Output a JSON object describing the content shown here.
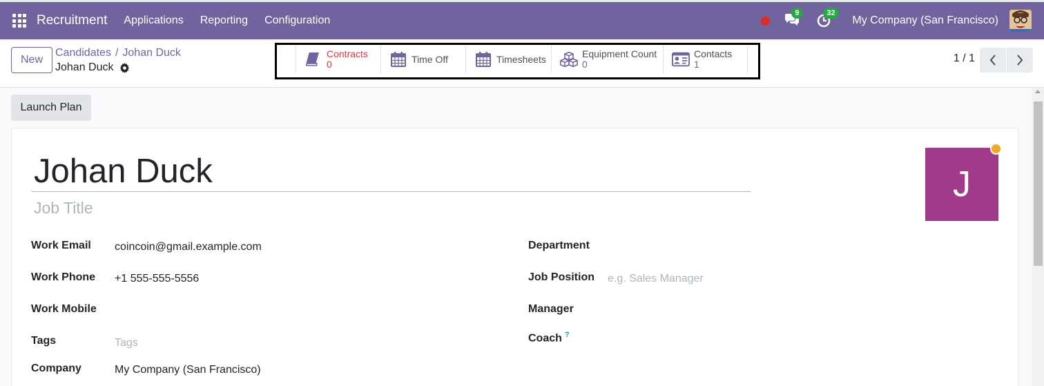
{
  "navbar": {
    "brand": "Recruitment",
    "menu": [
      "Applications",
      "Reporting",
      "Configuration"
    ],
    "messages_count": "9",
    "activities_count": "32",
    "company": "My Company (San Francisco)",
    "color": "#71639e"
  },
  "control": {
    "new_label": "New",
    "breadcrumb": [
      "Candidates",
      "Johan Duck"
    ],
    "record_name": "Johan Duck",
    "smart_buttons": [
      {
        "label": "Contracts",
        "count": "0",
        "icon": "book-icon"
      },
      {
        "label": "Time Off",
        "icon": "calendar-icon"
      },
      {
        "label": "Timesheets",
        "icon": "calendar-icon"
      },
      {
        "label": "Equipment Count",
        "count": "0",
        "icon": "cubes-icon"
      },
      {
        "label": "Contacts",
        "count": "1",
        "icon": "id-card-icon"
      }
    ],
    "pager": "1 / 1"
  },
  "form": {
    "launch_plan": "Launch Plan",
    "name": "Johan Duck",
    "job_title_placeholder": "Job Title",
    "avatar_letter": "J",
    "left_fields": [
      {
        "label": "Work Email",
        "value": "coincoin@gmail.example.com"
      },
      {
        "label": "Work Phone",
        "value": "+1 555-555-5556"
      },
      {
        "label": "Work Mobile",
        "value": ""
      },
      {
        "label": "Tags",
        "placeholder": "Tags"
      },
      {
        "label": "Company",
        "value": "My Company (San Francisco)"
      }
    ],
    "right_fields": [
      {
        "label": "Department",
        "value": ""
      },
      {
        "label": "Job Position",
        "placeholder": "e.g. Sales Manager"
      },
      {
        "label": "Manager",
        "value": ""
      },
      {
        "label": "Coach",
        "help": "?"
      }
    ]
  }
}
